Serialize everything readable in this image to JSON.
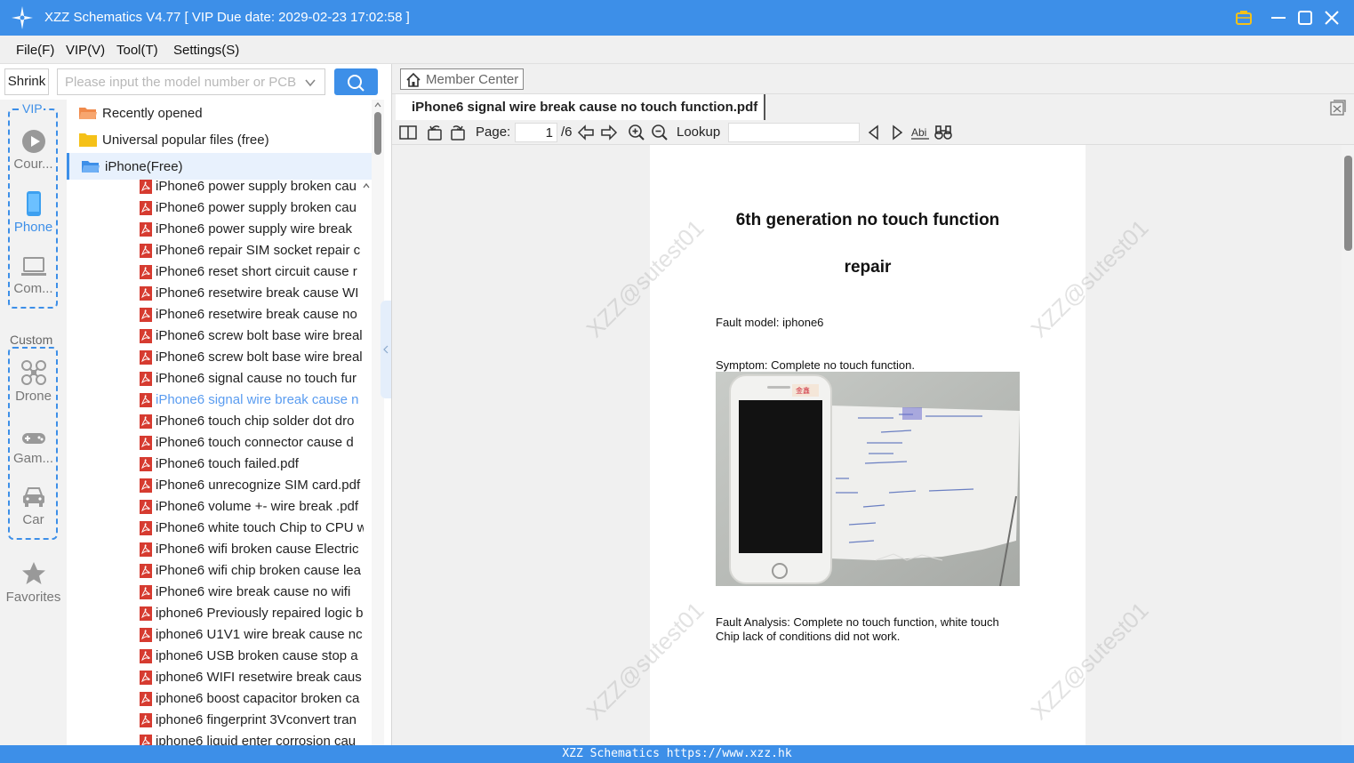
{
  "window": {
    "title": "XZZ Schematics V4.77 [ VIP Due date: 2029-02-23 17:02:58 ]"
  },
  "menu": [
    "File(F)",
    "VIP(V)",
    "Tool(T)",
    "Settings(S)"
  ],
  "search": {
    "shrink_label": "Shrink",
    "placeholder": "Please input the model number or PCB"
  },
  "categories": {
    "vip_group_label": "VIP",
    "vip": [
      {
        "label": "Cour...",
        "icon": "play-icon",
        "active": false
      },
      {
        "label": "Phone",
        "icon": "phone-icon",
        "active": true
      },
      {
        "label": "Com...",
        "icon": "laptop-icon",
        "active": false
      }
    ],
    "custom_group_label": "Custom",
    "custom": [
      {
        "label": "Drone",
        "icon": "drone-icon"
      },
      {
        "label": "Gam...",
        "icon": "gamepad-icon"
      },
      {
        "label": "Car",
        "icon": "car-icon"
      }
    ],
    "favorites_label": "Favorites"
  },
  "tree": {
    "folders": [
      {
        "label": "Recently opened",
        "icon": "folder-open-icon",
        "color": "#f08a4b"
      },
      {
        "label": "Universal popular files (free)",
        "icon": "folder-icon",
        "color": "#f5c118"
      },
      {
        "label": "iPhone(Free)",
        "icon": "folder-open-icon",
        "color": "#3d8fe8"
      }
    ],
    "files": [
      "iPhone6 power supply broken cau",
      "iPhone6 power supply broken cau",
      "iPhone6 power supply wire break",
      "iPhone6 repair SIM socket repair c",
      "iPhone6 reset short circuit cause  r",
      "iPhone6 resetwire break  cause WI",
      "iPhone6 resetwire break  cause no",
      "iPhone6 screw bolt base wire breal",
      "iPhone6 screw bolt base wire breal",
      "iPhone6 signal cause no touch fur",
      "iPhone6 signal wire break  cause n",
      "iPhone6 touch chip solder dot dro",
      "iPhone6 touch connector cause  d",
      "iPhone6 touch failed.pdf",
      "iPhone6 unrecognize SIM card.pdf",
      "iPhone6 volume +- wire break .pdf",
      "iPhone6 white touch Chip to CPU w",
      "iPhone6 wifi broken cause Electric",
      "iPhone6 wifi chip broken cause lea",
      "iPhone6 wire break  cause no wifi",
      "iphone6 Previously repaired logic b",
      "iphone6 U1V1 wire break  cause nc",
      "iphone6 USB broken cause  stop a",
      "iphone6 WIFI resetwire break  caus",
      "iphone6 boost capacitor broken ca",
      "iphone6 fingerprint 3Vconvert tran",
      "iphone6 liquid enter corrosion cau"
    ],
    "current_index": 10
  },
  "viewer": {
    "member_center_label": "Member Center",
    "tab_title": "iPhone6 signal wire break  cause no touch function.pdf",
    "page_label": "Page:",
    "current_page": "1",
    "total_pages": "/6",
    "lookup_label": "Lookup",
    "lookup_value": ""
  },
  "document": {
    "title_line1": "6th generation no touch function",
    "title_line2": "repair",
    "fault_model": "Fault model: iphone6",
    "symptom": "Symptom: Complete no touch function.",
    "analysis_line1": "Fault Analysis: Complete no touch function, white touch",
    "analysis_line2": "Chip lack of conditions did not work.",
    "watermark": "XZZ@sutest01"
  },
  "statusbar": {
    "text": "XZZ Schematics https://www.xzz.hk"
  },
  "colors": {
    "accent": "#3d8fe8",
    "pdf_icon": "#d63b30",
    "selected_file": "#5a9cf0"
  }
}
